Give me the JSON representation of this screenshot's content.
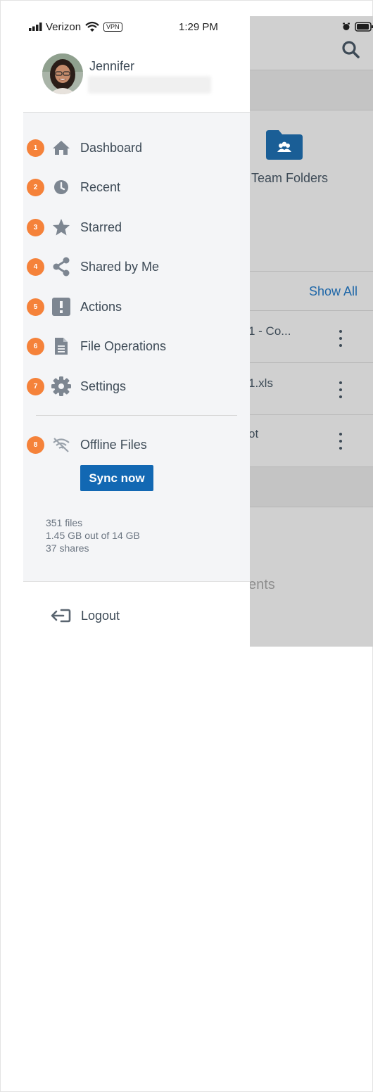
{
  "status_bar": {
    "carrier": "Verizon",
    "vpn": "VPN",
    "time": "1:29 PM"
  },
  "user": {
    "name": "Jennifer"
  },
  "menu": {
    "items": [
      {
        "badge": "1",
        "label": "Dashboard",
        "icon": "home-icon"
      },
      {
        "badge": "2",
        "label": "Recent",
        "icon": "clock-icon"
      },
      {
        "badge": "3",
        "label": "Starred",
        "icon": "star-icon"
      },
      {
        "badge": "4",
        "label": "Shared by Me",
        "icon": "share-icon"
      },
      {
        "badge": "5",
        "label": "Actions",
        "icon": "exclamation-icon"
      },
      {
        "badge": "6",
        "label": "File Operations",
        "icon": "file-icon"
      },
      {
        "badge": "7",
        "label": "Settings",
        "icon": "gear-icon"
      }
    ],
    "offline": {
      "badge": "8",
      "label": "Offline Files",
      "icon": "offline-icon"
    },
    "sync_label": "Sync now"
  },
  "stats": {
    "files": "351 files",
    "storage": "1.45 GB out of 14 GB",
    "shares": "37 shares"
  },
  "logout_label": "Logout",
  "background": {
    "team_folders_label": "Team Folders",
    "show_all_label": "Show All",
    "rows": [
      "1 - Co...",
      "1.xls",
      "ot"
    ],
    "recent_fragment": "ents"
  },
  "colors": {
    "accent": "#1268b3",
    "badge": "#f5823a",
    "text": "#3d4a56",
    "overlay": "#d0d0d0"
  }
}
